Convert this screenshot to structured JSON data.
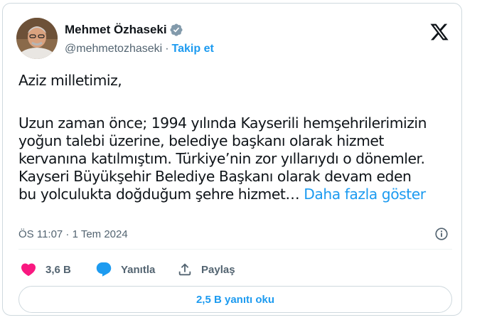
{
  "author": {
    "name": "Mehmet Özhaseki",
    "handle": "@mehmetozhaseki",
    "separator": "·",
    "follow_label": "Takip et",
    "verified_color": "#829aab"
  },
  "brand": {
    "icon": "x-logo-icon"
  },
  "tweet": {
    "lines": [
      "Aziz milletimiz,",
      "Uzun zaman önce; 1994 yılında Kayserili hemşehrilerimizin",
      "yoğun talebi üzerine, belediye başkanı olarak hizmet",
      "kervanına katılmıştım. Türkiye’nin zor yıllarıydı o dönemler.",
      "Kayseri Büyükşehir Belediye Başkanı olarak devam eden",
      "bu yolculukta doğduğum şehre hizmet…"
    ],
    "show_more_label": "Daha fazla göster",
    "timestamp": "ÖS 11:07 · 1 Tem 2024"
  },
  "actions": {
    "like_count": "3,6 B",
    "like_color": "#f91880",
    "reply_label": "Yanıtla",
    "reply_icon_color": "#1d9bf0",
    "share_label": "Paylaş"
  },
  "read_replies_label": "2,5 B yanıtı oku",
  "colors": {
    "accent": "#1d9bf0",
    "text": "#0f1419",
    "muted": "#536471",
    "border": "#cfd9de"
  }
}
